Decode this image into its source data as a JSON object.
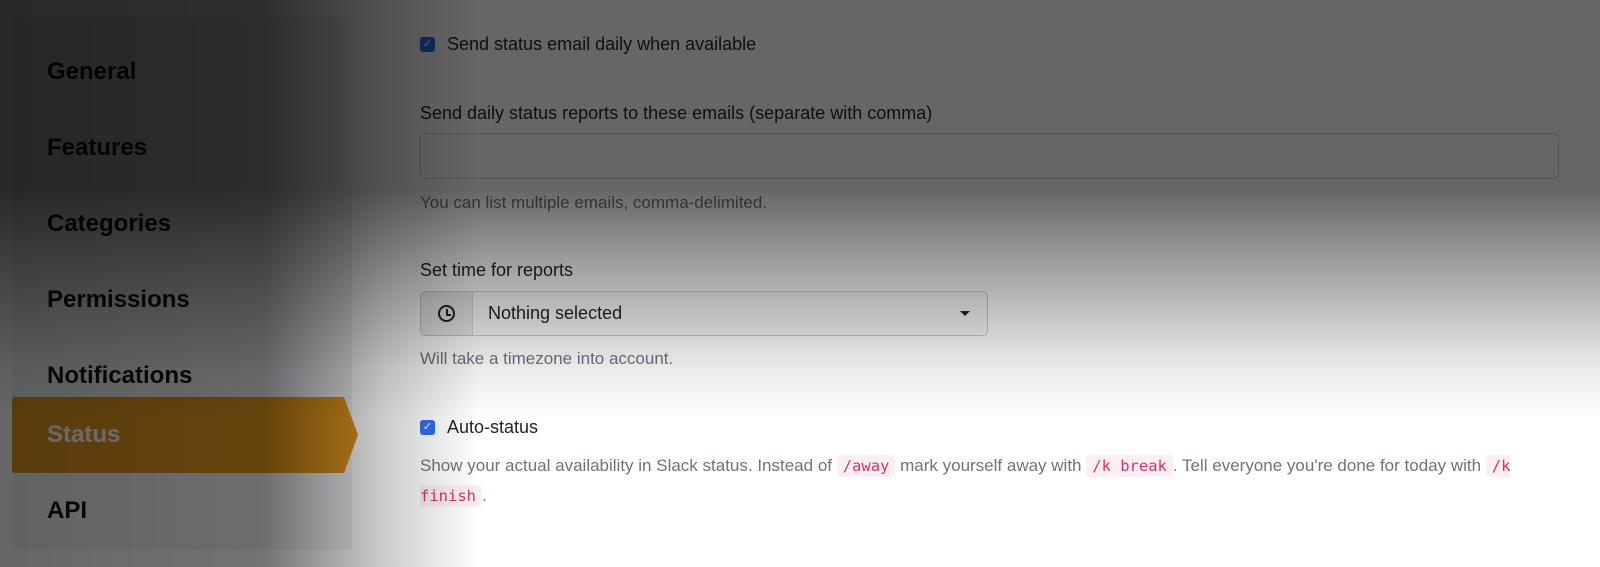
{
  "sidebar": {
    "items": [
      {
        "label": "General"
      },
      {
        "label": "Features"
      },
      {
        "label": "Categories"
      },
      {
        "label": "Permissions"
      },
      {
        "label": "Notifications"
      },
      {
        "label": "Status",
        "active": true
      },
      {
        "label": "API"
      }
    ],
    "active_color": "#e0961d"
  },
  "form": {
    "daily_email": {
      "label": "Send status email daily when available",
      "checked": true
    },
    "emails_field": {
      "label": "Send daily status reports to these emails (separate with comma)",
      "value": "",
      "placeholder": "",
      "help": "You can list multiple emails, comma-delimited."
    },
    "report_time": {
      "label": "Set time for reports",
      "icon": "clock-icon",
      "selected": "Nothing selected",
      "help": "Will take a timezone into account."
    },
    "auto_status": {
      "label": "Auto-status",
      "checked": true,
      "desc_parts": {
        "p1": "Show your actual availability in Slack status. Instead of ",
        "code1": "/away",
        "p2": " mark yourself away with ",
        "code2": "/k break",
        "p3": ". Tell everyone you're done for today with ",
        "code3": "/k finish",
        "p4": "."
      }
    }
  },
  "colors": {
    "checkbox": "#2f6ff0",
    "code_text": "#d6336c"
  }
}
